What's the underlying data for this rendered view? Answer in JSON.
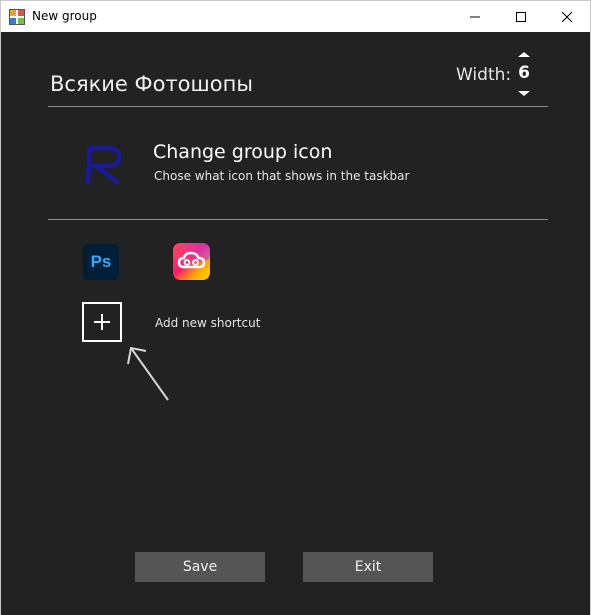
{
  "window": {
    "title": "New group",
    "icons": {
      "app": "app-icon",
      "minimize": "minimize-icon",
      "maximize": "maximize-icon",
      "close": "close-icon"
    }
  },
  "header": {
    "group_name": "Всякие Фотошопы",
    "width_label": "Width:",
    "width_value": "6"
  },
  "group_icon": {
    "title": "Change group icon",
    "subtitle": "Chose what icon that shows in the taskbar"
  },
  "shortcuts": [
    {
      "name": "photoshop-icon",
      "label": "Ps",
      "color": "#31a8ff",
      "background": "#001e36"
    },
    {
      "name": "creative-cloud-icon"
    }
  ],
  "add_shortcut": {
    "label": "Add new shortcut"
  },
  "buttons": {
    "save": "Save",
    "exit": "Exit"
  },
  "colors": {
    "background": "#222222",
    "button": "#555555",
    "text": "#ffffff",
    "divider": "#8a8a8a",
    "icon_r": "#1a1a9a"
  }
}
